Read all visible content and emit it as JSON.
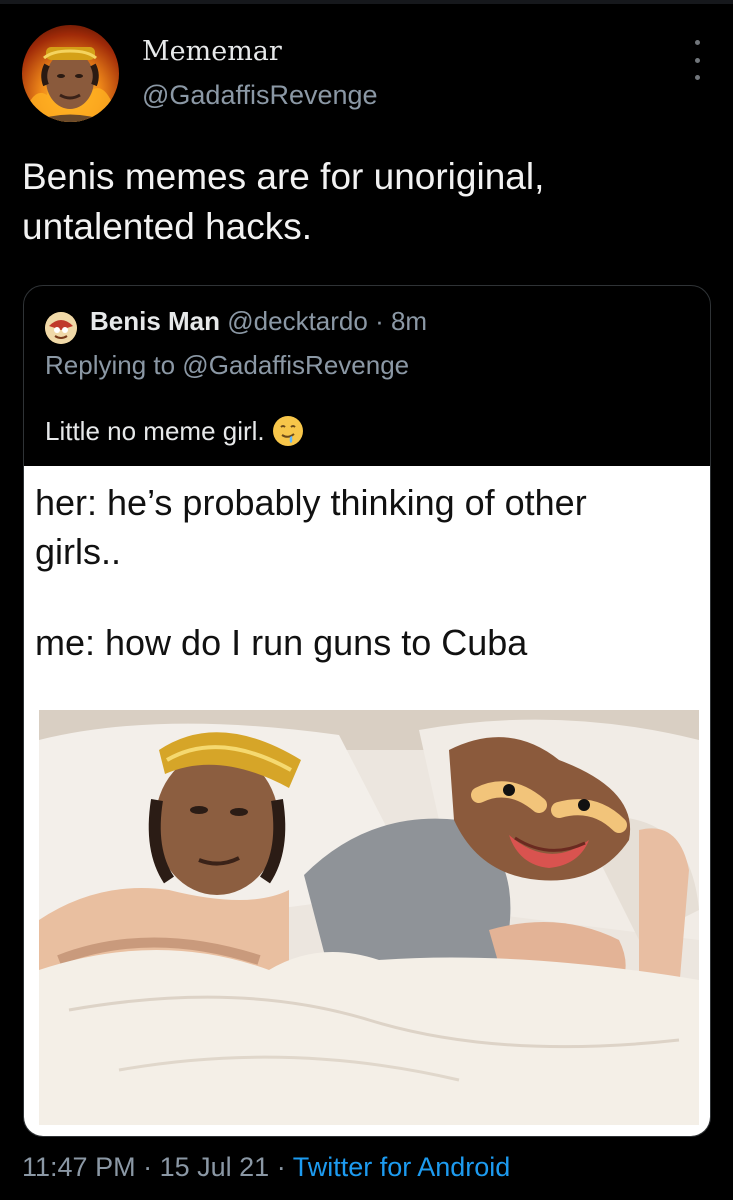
{
  "tweet": {
    "display_name": "Mememar",
    "handle": "@GadaffisRevenge",
    "text": "Benis memes are for unoriginal, untalented hacks."
  },
  "quoted": {
    "name": "Benis Man",
    "meta": "@decktardo · 8m",
    "replying_to": "Replying to @GadaffisRevenge",
    "text": "Little no meme girl.",
    "meme_line1": "her: he’s probably thinking of other girls..",
    "meme_line2": "me: how do I run guns to Cuba"
  },
  "footer": {
    "time": "11:47 PM",
    "date": "15 Jul 21",
    "source": "Twitter for Android"
  },
  "colors": {
    "background": "#000000",
    "secondary_text": "#8b98a5",
    "link": "#1d9bf0"
  },
  "icons": [
    "more-vertical-icon",
    "drooling-emoji-icon"
  ]
}
